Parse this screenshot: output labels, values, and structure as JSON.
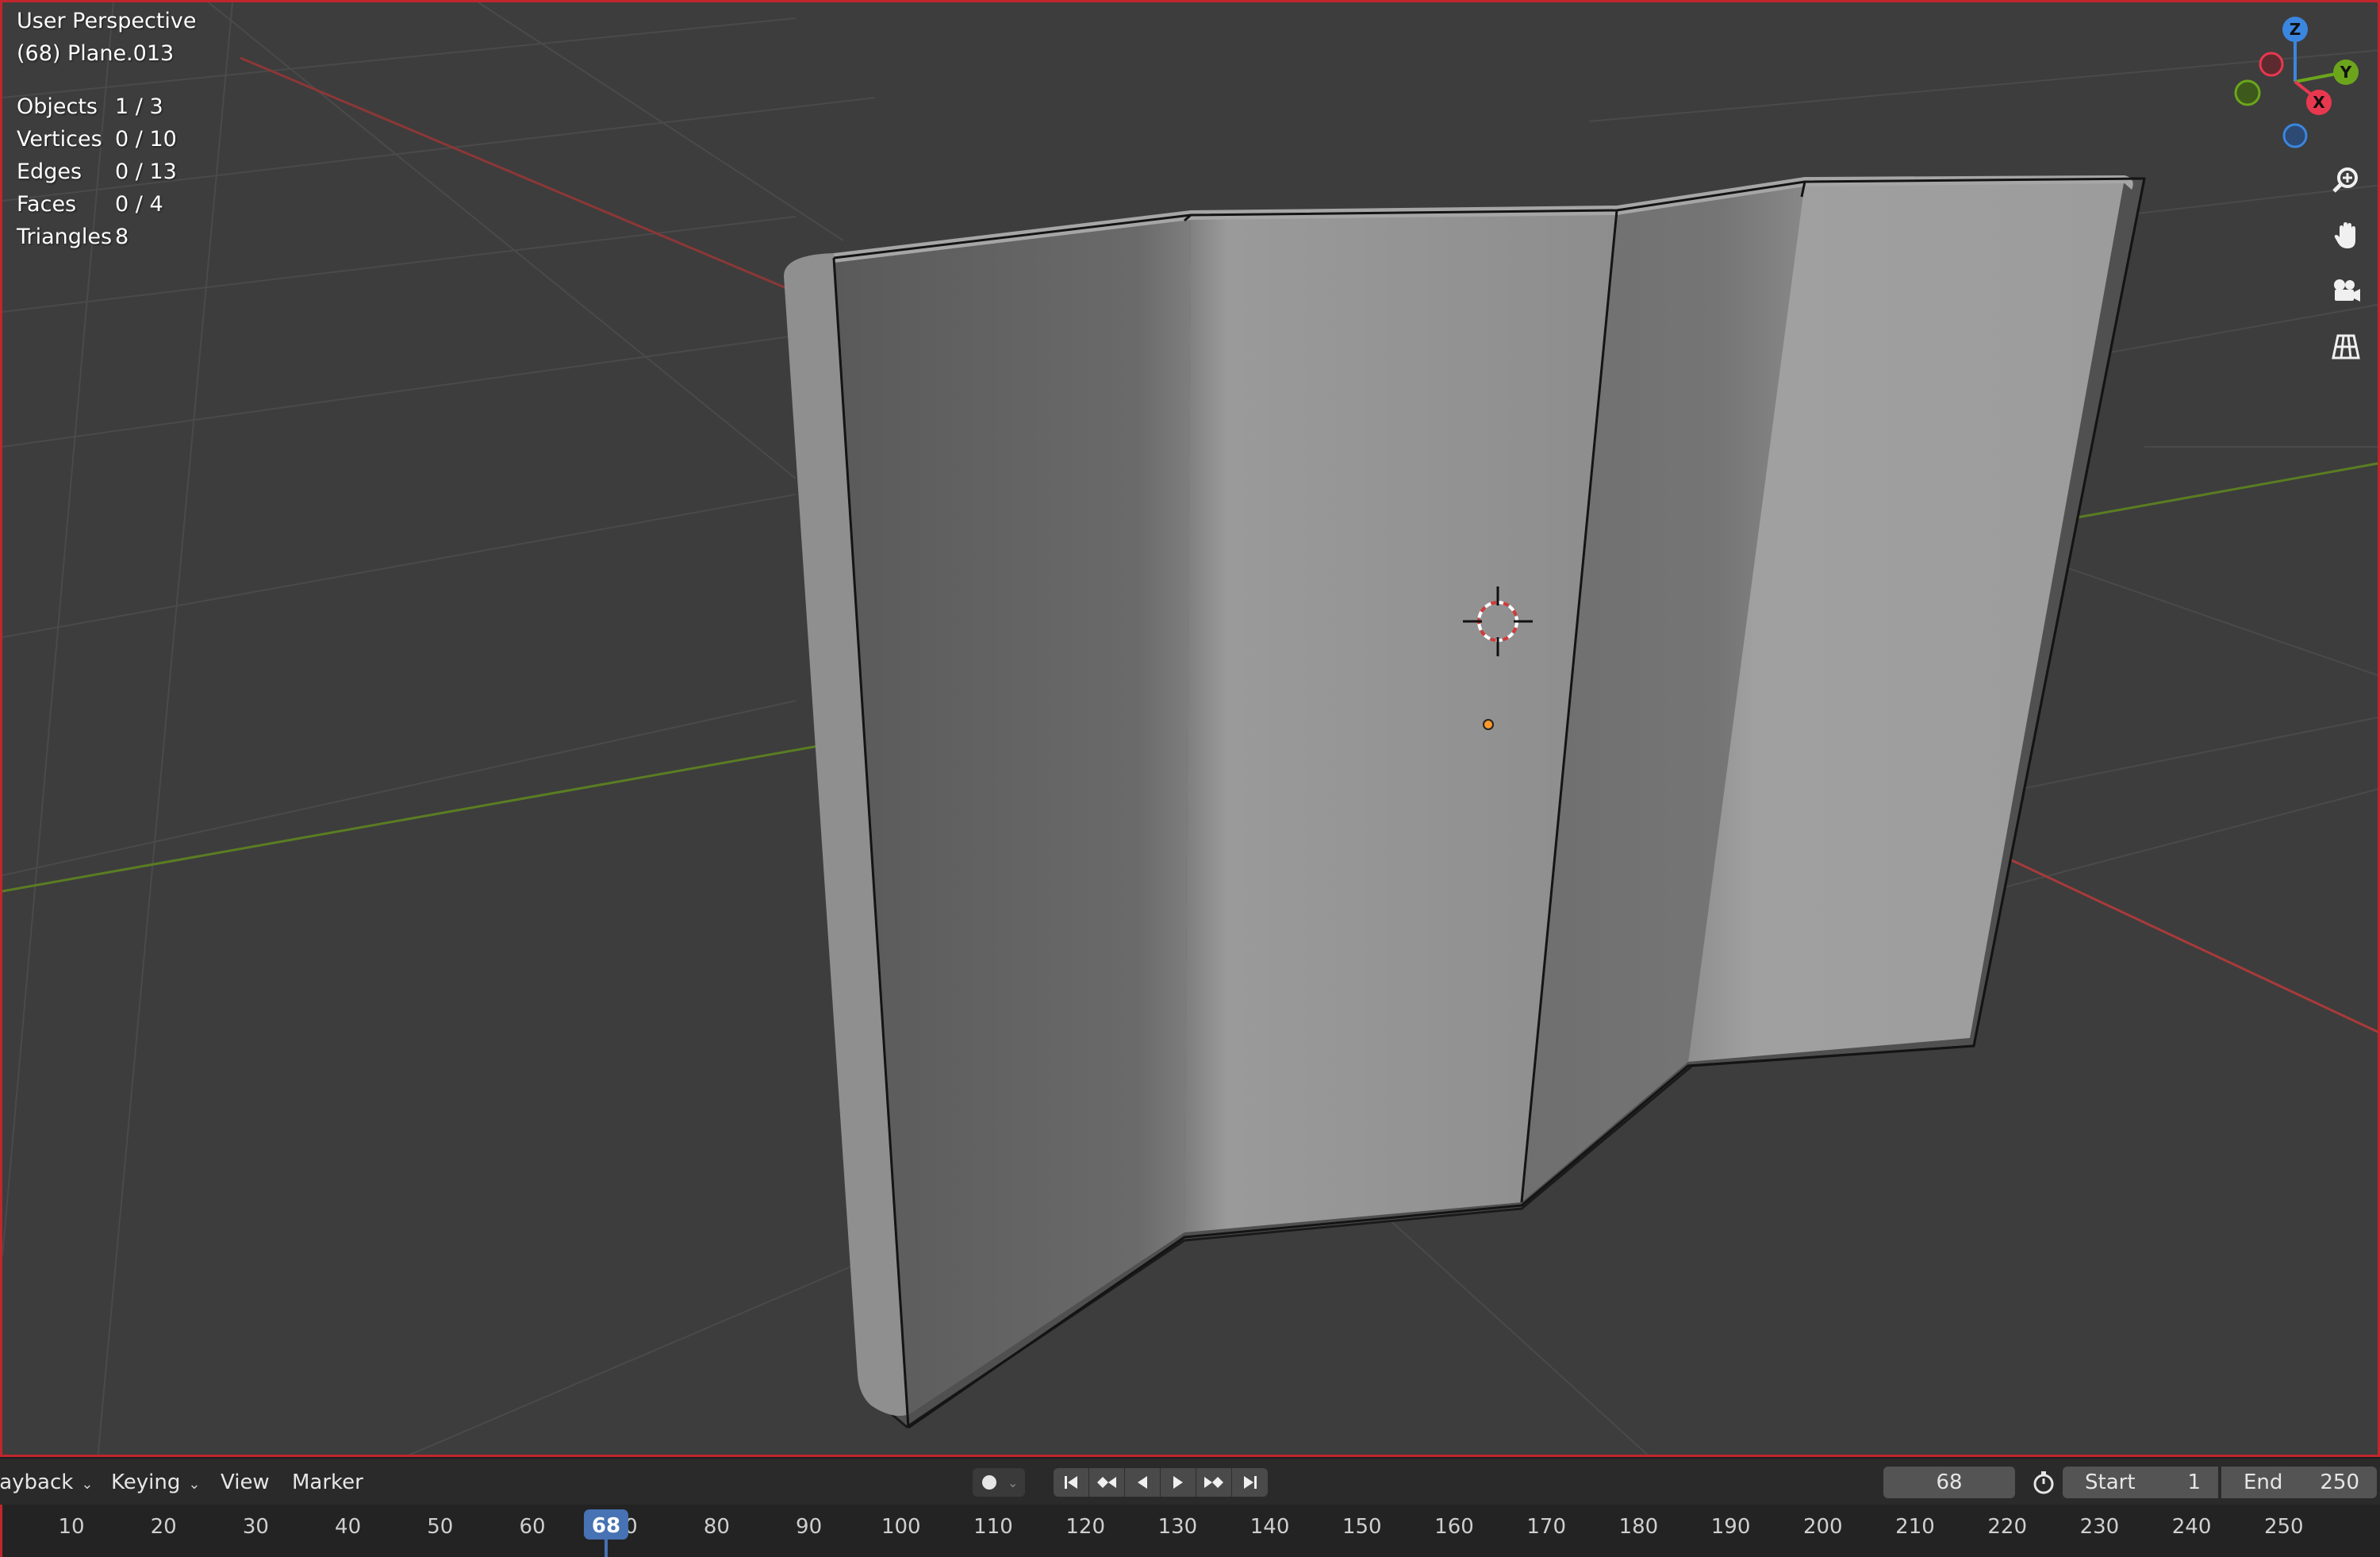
{
  "viewport": {
    "view_title": "User Perspective",
    "object_name": "(68) Plane.013",
    "stats": [
      {
        "label": "Objects",
        "value": "1 / 3"
      },
      {
        "label": "Vertices",
        "value": "0 / 10"
      },
      {
        "label": "Edges",
        "value": "0 / 13"
      },
      {
        "label": "Faces",
        "value": "0 / 4"
      },
      {
        "label": "Triangles",
        "value": "8"
      }
    ]
  },
  "gizmo": {
    "x_label": "X",
    "y_label": "Y",
    "z_label": "Z",
    "colors": {
      "x": "#e8384f",
      "y": "#6ca51c",
      "z": "#3b86e0"
    }
  },
  "nav_tools": [
    "zoom-icon",
    "pan-hand-icon",
    "camera-icon",
    "orthographic-grid-icon"
  ],
  "timeline": {
    "menus": {
      "playback": "layback",
      "keying": "Keying",
      "view": "View",
      "marker": "Marker"
    },
    "transport_icons": [
      "jump-to-start-icon",
      "prev-keyframe-icon",
      "play-reverse-icon",
      "play-icon",
      "next-keyframe-icon",
      "jump-to-end-icon"
    ],
    "current_frame": "68",
    "start_label": "Start",
    "start_value": "1",
    "end_label": "End",
    "end_value": "250",
    "ruler_ticks": [
      "10",
      "20",
      "30",
      "40",
      "50",
      "60",
      "80",
      "90",
      "100",
      "110",
      "120",
      "130",
      "140",
      "150",
      "160",
      "170",
      "180",
      "190",
      "200",
      "210",
      "220",
      "230",
      "240",
      "250"
    ],
    "playhead_frame": "68",
    "playhead_color": "#4772b3"
  }
}
